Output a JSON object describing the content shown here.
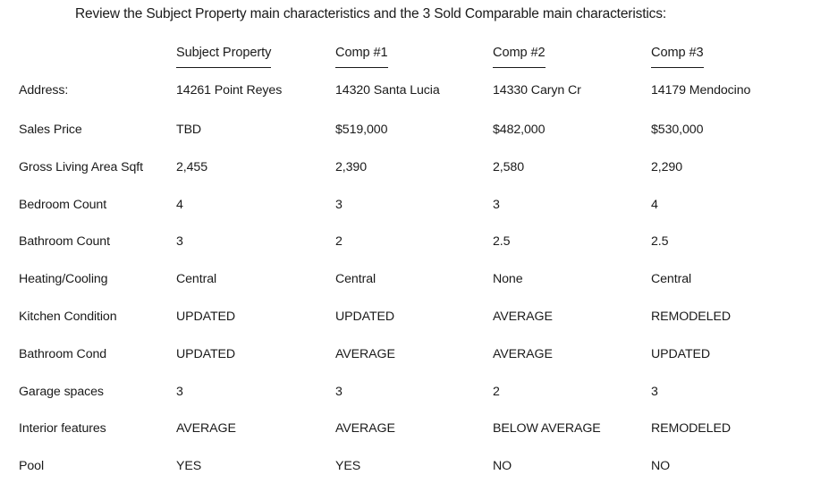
{
  "document": {
    "title": "Review the Subject Property main characteristics and the 3 Sold Comparable main characteristics:"
  },
  "table": {
    "corner_label": "",
    "columns": [
      {
        "label": "Subject Property"
      },
      {
        "label": "Comp #1"
      },
      {
        "label": "Comp #2"
      },
      {
        "label": "Comp #3"
      }
    ],
    "rows": [
      {
        "label": "Address:",
        "values": [
          "14261 Point Reyes",
          "14320 Santa Lucia",
          "14330 Caryn Cr",
          "14179 Mendocino"
        ]
      },
      {
        "label": "Sales Price",
        "values": [
          "TBD",
          "$519,000",
          "$482,000",
          "$530,000"
        ]
      },
      {
        "label": "Gross Living Area Sqft",
        "values": [
          "2,455",
          "2,390",
          "2,580",
          "2,290"
        ]
      },
      {
        "label": "Bedroom Count",
        "values": [
          "4",
          "3",
          "3",
          "4"
        ]
      },
      {
        "label": "Bathroom Count",
        "values": [
          "3",
          "2",
          "2.5",
          "2.5"
        ]
      },
      {
        "label": "Heating/Cooling",
        "values": [
          "Central",
          "Central",
          "None",
          "Central"
        ]
      },
      {
        "label": "Kitchen Condition",
        "values": [
          "UPDATED",
          "UPDATED",
          "AVERAGE",
          "REMODELED"
        ]
      },
      {
        "label": "Bathroom Cond",
        "values": [
          "UPDATED",
          "AVERAGE",
          "AVERAGE",
          "UPDATED"
        ]
      },
      {
        "label": "Garage spaces",
        "values": [
          "3",
          "3",
          "2",
          "3"
        ]
      },
      {
        "label": "Interior features",
        "values": [
          "AVERAGE",
          "AVERAGE",
          "BELOW AVERAGE",
          "REMODELED"
        ]
      },
      {
        "label": "Pool",
        "values": [
          "YES",
          "YES",
          "NO",
          "NO"
        ]
      }
    ]
  },
  "colors": {
    "text": "#1a1a1a",
    "background": "#ffffff",
    "rule": "#1a1a1a"
  }
}
